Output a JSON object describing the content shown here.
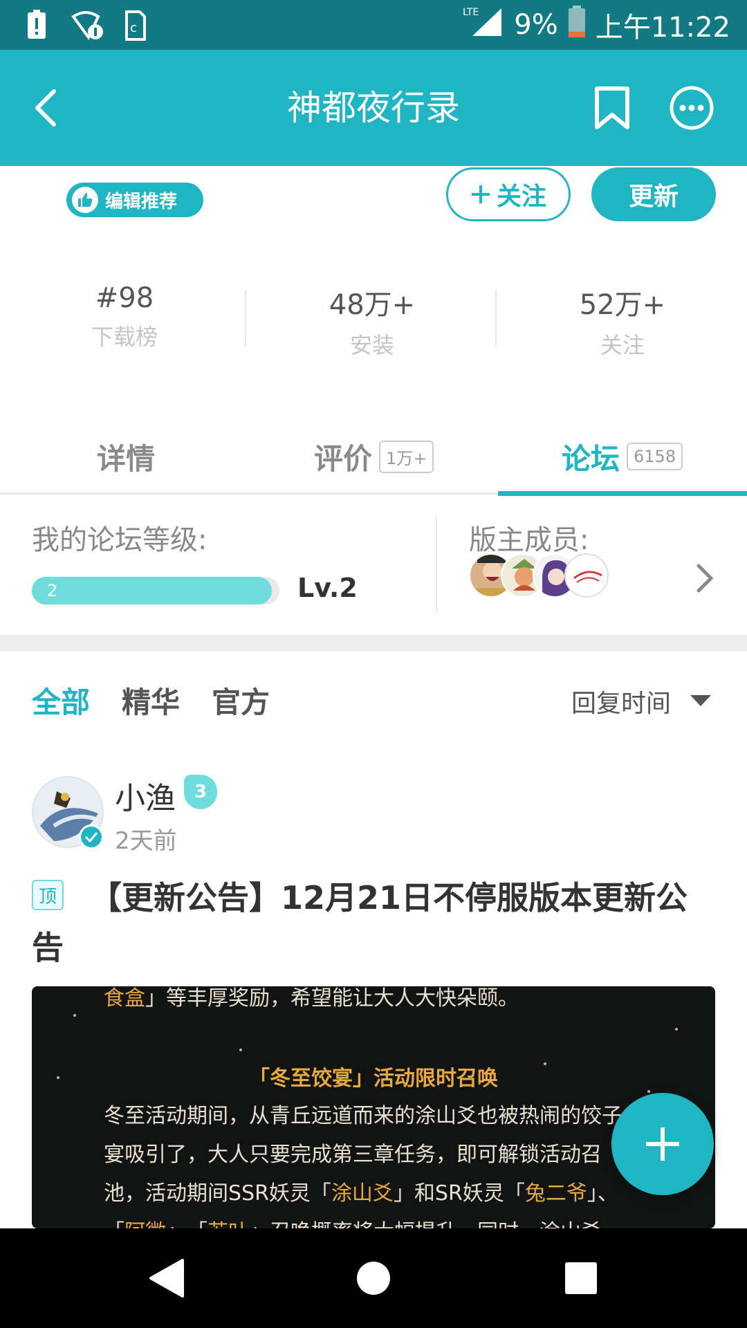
{
  "status_bar": {
    "battery": "9%",
    "time": "上午11:22",
    "network": "LTE"
  },
  "header": {
    "title": "神都夜行录"
  },
  "app": {
    "recommend_badge": "编辑推荐",
    "follow_label": "关注",
    "update_label": "更新",
    "stats": [
      {
        "value": "#98",
        "label": "下载榜"
      },
      {
        "value": "48万+",
        "label": "安装"
      },
      {
        "value": "52万+",
        "label": "关注"
      }
    ]
  },
  "tabs": [
    {
      "label": "详情",
      "count": ""
    },
    {
      "label": "评价",
      "count": "1万+"
    },
    {
      "label": "论坛",
      "count": "6158",
      "active": true
    }
  ],
  "forum": {
    "level_label": "我的论坛等级:",
    "level_number": "2",
    "level_text": "Lv.2",
    "level_progress": 0.97,
    "moderators_label": "版主成员:"
  },
  "filters": {
    "items": [
      "全部",
      "精华",
      "官方"
    ],
    "active": "全部",
    "sort_label": "回复时间"
  },
  "post": {
    "author": "小渔",
    "author_level": "3",
    "time": "2天前",
    "pin_label": "顶",
    "title": "【更新公告】12月21日不停服版本更新公告",
    "image_text": {
      "line0_gold": "食盒",
      "line0_rest": "」等丰厚奖励，希望能让大人大快朵颐。",
      "heading": "「冬至饺宴」活动限时召唤",
      "line1": "冬至活动期间，从青丘远道而来的涂山爻也被热闹的饺子",
      "line2": "宴吸引了，大人只要完成第三章任务，即可解锁活动召",
      "line3_a": "池，活动期间SSR妖灵「",
      "line3_gold1": "涂山爻",
      "line3_b": "」和SR妖灵「",
      "line3_gold2": "兔二爷",
      "line3_c": "」、",
      "line4_a": "「",
      "line4_gold1": "阿微",
      "line4_b": "」、「",
      "line4_gold2": "若叶",
      "line4_c": "」召唤概率将大幅提升，同时，涂山爻"
    }
  },
  "colors": {
    "accent": "#1fb5c2",
    "status_bar": "#117a82",
    "level_fill": "#6fdcdc"
  }
}
